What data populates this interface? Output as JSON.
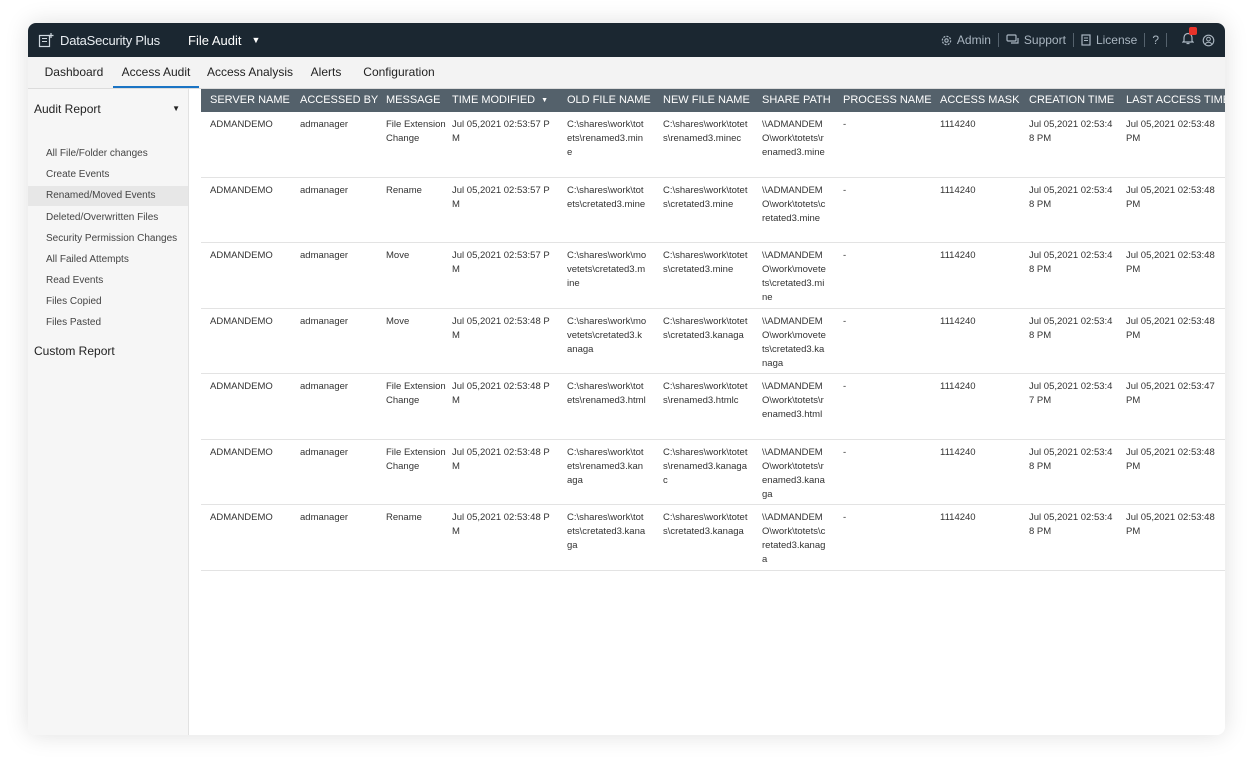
{
  "app": {
    "brand": "DataSecurity Plus",
    "module": "File Audit",
    "admin_label": "Admin",
    "support_label": "Support",
    "license_label": "License",
    "help_label": "?"
  },
  "nav": {
    "tabs": [
      {
        "label": "Dashboard"
      },
      {
        "label": "Access Audit"
      },
      {
        "label": "Access Analysis"
      },
      {
        "label": "Alerts"
      },
      {
        "label": "Configuration"
      }
    ],
    "active_tab": "Access Audit"
  },
  "sidebar": {
    "heading": "Audit Report",
    "items": [
      {
        "label": "All File/Folder changes"
      },
      {
        "label": "Create Events"
      },
      {
        "label": "Renamed/Moved Events"
      },
      {
        "label": "Deleted/Overwritten Files"
      },
      {
        "label": "Security Permission Changes"
      },
      {
        "label": "All Failed Attempts"
      },
      {
        "label": "Read Events"
      },
      {
        "label": "Files Copied"
      },
      {
        "label": "Files Pasted"
      }
    ],
    "active_item": "Renamed/Moved Events",
    "custom_report": "Custom Report"
  },
  "table": {
    "headers": [
      "SERVER NAME",
      "ACCESSED BY",
      "MESSAGE",
      "TIME MODIFIED",
      "OLD FILE NAME",
      "NEW FILE NAME",
      "SHARE PATH",
      "PROCESS NAME",
      "ACCESS MASK",
      "CREATION TIME",
      "LAST ACCESS TIME"
    ],
    "sorted_column": "TIME MODIFIED",
    "rows": [
      [
        "ADMANDEMO",
        "admanager",
        "File Extension Change",
        "Jul 05,2021 02:53:57 PM",
        "C:\\shares\\work\\totets\\renamed3.mine",
        "C:\\shares\\work\\totets\\renamed3.minec",
        "\\\\ADMANDEMO\\work\\totets\\renamed3.mine",
        "-",
        "1114240",
        "Jul 05,2021 02:53:48 PM",
        "Jul 05,2021 02:53:48 PM"
      ],
      [
        "ADMANDEMO",
        "admanager",
        "Rename",
        "Jul 05,2021 02:53:57 PM",
        "C:\\shares\\work\\totets\\cretated3.mine",
        "C:\\shares\\work\\totets\\cretated3.mine",
        "\\\\ADMANDEMO\\work\\totets\\cretated3.mine",
        "-",
        "1114240",
        "Jul 05,2021 02:53:48 PM",
        "Jul 05,2021 02:53:48 PM"
      ],
      [
        "ADMANDEMO",
        "admanager",
        "Move",
        "Jul 05,2021 02:53:57 PM",
        "C:\\shares\\work\\movetets\\cretated3.mine",
        "C:\\shares\\work\\totets\\cretated3.mine",
        "\\\\ADMANDEMO\\work\\movetets\\cretated3.mine",
        "-",
        "1114240",
        "Jul 05,2021 02:53:48 PM",
        "Jul 05,2021 02:53:48 PM"
      ],
      [
        "ADMANDEMO",
        "admanager",
        "Move",
        "Jul 05,2021 02:53:48 PM",
        "C:\\shares\\work\\movetets\\cretated3.kanaga",
        "C:\\shares\\work\\totets\\cretated3.kanaga",
        "\\\\ADMANDEMO\\work\\movetets\\cretated3.kanaga",
        "-",
        "1114240",
        "Jul 05,2021 02:53:48 PM",
        "Jul 05,2021 02:53:48 PM"
      ],
      [
        "ADMANDEMO",
        "admanager",
        "File Extension Change",
        "Jul 05,2021 02:53:48 PM",
        "C:\\shares\\work\\totets\\renamed3.html",
        "C:\\shares\\work\\totets\\renamed3.htmlc",
        "\\\\ADMANDEMO\\work\\totets\\renamed3.html",
        "-",
        "1114240",
        "Jul 05,2021 02:53:47 PM",
        "Jul 05,2021 02:53:47 PM"
      ],
      [
        "ADMANDEMO",
        "admanager",
        "File Extension Change",
        "Jul 05,2021 02:53:48 PM",
        "C:\\shares\\work\\totets\\renamed3.kanaga",
        "C:\\shares\\work\\totets\\renamed3.kanagac",
        "\\\\ADMANDEMO\\work\\totets\\renamed3.kanaga",
        "-",
        "1114240",
        "Jul 05,2021 02:53:48 PM",
        "Jul 05,2021 02:53:48 PM"
      ],
      [
        "ADMANDEMO",
        "admanager",
        "Rename",
        "Jul 05,2021 02:53:48 PM",
        "C:\\shares\\work\\totets\\cretated3.kanaga",
        "C:\\shares\\work\\totets\\cretated3.kanaga",
        "\\\\ADMANDEMO\\work\\totets\\cretated3.kanaga",
        "-",
        "1114240",
        "Jul 05,2021 02:53:48 PM",
        "Jul 05,2021 02:53:48 PM"
      ]
    ]
  },
  "colors": {
    "topbar": "#1b2731",
    "table_header": "#54616b",
    "accent": "#1a74c4",
    "badge": "#e8332a"
  },
  "icons": [
    "product-logo-icon",
    "dropdown-caret-icon",
    "admin-gear-icon",
    "support-chat-icon",
    "license-icon",
    "help-icon",
    "notification-bell-icon",
    "user-profile-icon",
    "sort-descending-icon",
    "collapse-caret-icon"
  ]
}
